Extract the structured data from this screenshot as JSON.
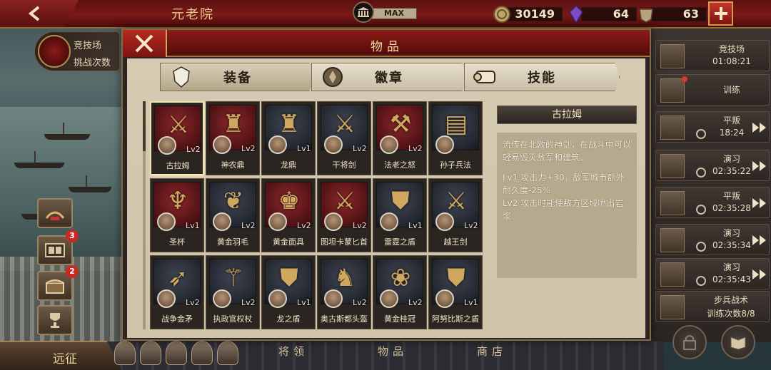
{
  "topbar": {
    "title": "元老院",
    "senate_level": "MAX",
    "gold": "30149",
    "gems": "64",
    "honor": "63"
  },
  "arena_badge": {
    "line1": "竞技场",
    "line2": "挑战次数"
  },
  "left_icons": [
    {
      "name": "laurel-icon",
      "badge": ""
    },
    {
      "name": "film-icon",
      "badge": "3"
    },
    {
      "name": "chest-icon",
      "badge": "2"
    },
    {
      "name": "trophy-icon",
      "badge": ""
    }
  ],
  "expedition_label": "远征",
  "bottom_tabs": [
    "将领",
    "物品",
    "商店"
  ],
  "panel": {
    "title": "物品",
    "tabs": [
      {
        "label": "装备",
        "icon": "armor-icon",
        "active": true
      },
      {
        "label": "徽章",
        "icon": "emblem-icon",
        "active": false
      },
      {
        "label": "技能",
        "icon": "scroll-icon",
        "active": false
      }
    ]
  },
  "items": [
    {
      "name": "古拉姆",
      "lv": "Lv2",
      "bg": "red",
      "glyph": "⚔",
      "selected": true
    },
    {
      "name": "神农鼎",
      "lv": "Lv2",
      "bg": "red",
      "glyph": "♜",
      "selected": false
    },
    {
      "name": "龙鼎",
      "lv": "Lv1",
      "bg": "dark",
      "glyph": "♜",
      "selected": false
    },
    {
      "name": "干将剑",
      "lv": "Lv2",
      "bg": "dark",
      "glyph": "⚔",
      "selected": false
    },
    {
      "name": "法老之怒",
      "lv": "Lv2",
      "bg": "red",
      "glyph": "⚒",
      "selected": false
    },
    {
      "name": "孙子兵法",
      "lv": "",
      "bg": "dark",
      "glyph": "▤",
      "selected": false
    },
    {
      "name": "圣杯",
      "lv": "Lv1",
      "bg": "red",
      "glyph": "♆",
      "selected": false
    },
    {
      "name": "黄金羽毛",
      "lv": "Lv2",
      "bg": "dark",
      "glyph": "❦",
      "selected": false
    },
    {
      "name": "黄金面具",
      "lv": "Lv2",
      "bg": "red",
      "glyph": "♚",
      "selected": false
    },
    {
      "name": "图坦卡蒙匕首",
      "lv": "Lv2",
      "bg": "red",
      "glyph": "⚔",
      "selected": false
    },
    {
      "name": "雷霆之盾",
      "lv": "Lv1",
      "bg": "dark",
      "glyph": "⛊",
      "selected": false
    },
    {
      "name": "越王剑",
      "lv": "Lv2",
      "bg": "dark",
      "glyph": "⚔",
      "selected": false
    },
    {
      "name": "战争金矛",
      "lv": "Lv2",
      "bg": "dark",
      "glyph": "➶",
      "selected": false
    },
    {
      "name": "执政官权杖",
      "lv": "Lv2",
      "bg": "dark",
      "glyph": "⚚",
      "selected": false
    },
    {
      "name": "龙之盾",
      "lv": "Lv1",
      "bg": "dark",
      "glyph": "⛊",
      "selected": false
    },
    {
      "name": "奥古斯都头盔",
      "lv": "Lv2",
      "bg": "dark",
      "glyph": "♞",
      "selected": false
    },
    {
      "name": "黄金桂冠",
      "lv": "Lv2",
      "bg": "dark",
      "glyph": "❀",
      "selected": false
    },
    {
      "name": "阿努比斯之盾",
      "lv": "Lv1",
      "bg": "dark",
      "glyph": "⛊",
      "selected": false
    }
  ],
  "detail": {
    "title": "古拉姆",
    "description": "流传在北欧的神剑，在战斗中可以轻易毁灭敌军和建筑。",
    "lv1": "Lv1  攻击力+30，敌军城市额外耐久度-25%",
    "lv2": "Lv2  攻击时能使敌方区域喷出岩浆"
  },
  "timers": [
    {
      "name": "竞技场",
      "time": "01:08:21",
      "speed": false,
      "dot": false,
      "icon": "swords-icon"
    },
    {
      "name": "训练",
      "time": "",
      "speed": false,
      "dot": true,
      "icon": "helmet-icon"
    },
    {
      "name": "平叛",
      "time": "18:24",
      "speed": true,
      "dot": false,
      "icon": "helmet-icon"
    },
    {
      "name": "演习",
      "time": "02:35:22",
      "speed": true,
      "dot": false,
      "icon": "crossed-icon"
    },
    {
      "name": "平叛",
      "time": "02:35:28",
      "speed": true,
      "dot": false,
      "icon": "helmet-icon"
    },
    {
      "name": "演习",
      "time": "02:35:34",
      "speed": true,
      "dot": false,
      "icon": "crossed-icon"
    },
    {
      "name": "演习",
      "time": "02:35:43",
      "speed": true,
      "dot": false,
      "icon": "crossed-icon"
    },
    {
      "name": "步兵战术",
      "time": "训练次数8/8",
      "speed": false,
      "dot": false,
      "icon": "sword-icon"
    }
  ]
}
